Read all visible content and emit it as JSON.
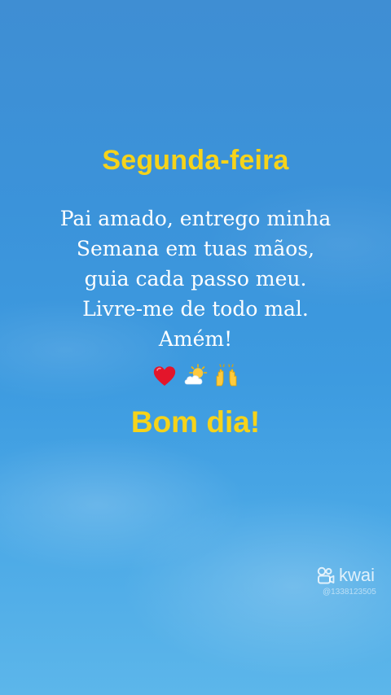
{
  "post": {
    "title": "Segunda-feira",
    "prayer_lines": [
      "Pai amado, entrego minha",
      "Semana em tuas mãos,",
      "guia cada passo meu.",
      "Livre-me de todo mal.",
      "Amém!"
    ],
    "emojis": [
      "red-heart",
      "sun-behind-cloud",
      "raising-hands"
    ],
    "greeting": "Bom dia!"
  },
  "watermark": {
    "brand": "kwai",
    "handle": "@1338123505",
    "logo_icon": "kwai-logo-icon"
  },
  "colors": {
    "title": "#f6d31a",
    "body_text": "#ffffff",
    "sky_top": "#3f8ed3",
    "sky_bottom": "#5cb6ea"
  }
}
